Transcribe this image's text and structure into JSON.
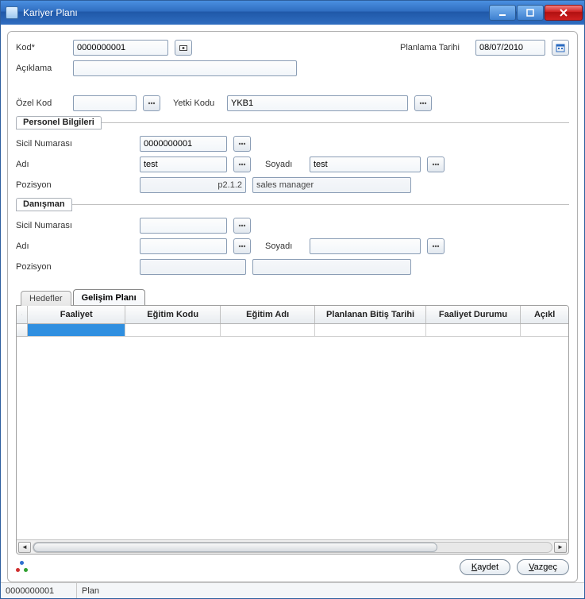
{
  "window": {
    "title": "Kariyer Planı"
  },
  "top": {
    "kod_label": "Kod*",
    "kod_value": "0000000001",
    "aciklama_label": "Açıklama",
    "aciklama_value": "",
    "planlama_tarihi_label": "Planlama Tarihi",
    "planlama_tarihi_value": "08/07/2010"
  },
  "auth": {
    "ozel_kod_label": "Özel Kod",
    "ozel_kod_value": "",
    "yetki_kodu_label": "Yetki Kodu",
    "yetki_kodu_value": "YKB1"
  },
  "personel": {
    "legend": "Personel Bilgileri",
    "sicil_label": "Sicil Numarası",
    "sicil_value": "0000000001",
    "adi_label": "Adı",
    "adi_value": "test",
    "soyadi_label": "Soyadı",
    "soyadi_value": "test",
    "pozisyon_label": "Pozisyon",
    "pozisyon_code": "p2.1.2",
    "pozisyon_text": "sales manager"
  },
  "danisman": {
    "legend": "Danışman",
    "sicil_label": "Sicil Numarası",
    "sicil_value": "",
    "adi_label": "Adı",
    "adi_value": "",
    "soyadi_label": "Soyadı",
    "soyadi_value": "",
    "pozisyon_label": "Pozisyon",
    "pozisyon_code": "",
    "pozisyon_text": ""
  },
  "tabs": {
    "hedefler": "Hedefler",
    "gelisim_plani": "Gelişim Planı"
  },
  "grid": {
    "columns": [
      "Faaliyet",
      "Eğitim Kodu",
      "Eğitim Adı",
      "Planlanan Bitiş Tarihi",
      "Faaliyet Durumu",
      "Açıkl"
    ]
  },
  "buttons": {
    "kaydet": "Kaydet",
    "vazgec": "Vazgeç"
  },
  "status": {
    "code": "0000000001",
    "plan": "Plan"
  }
}
